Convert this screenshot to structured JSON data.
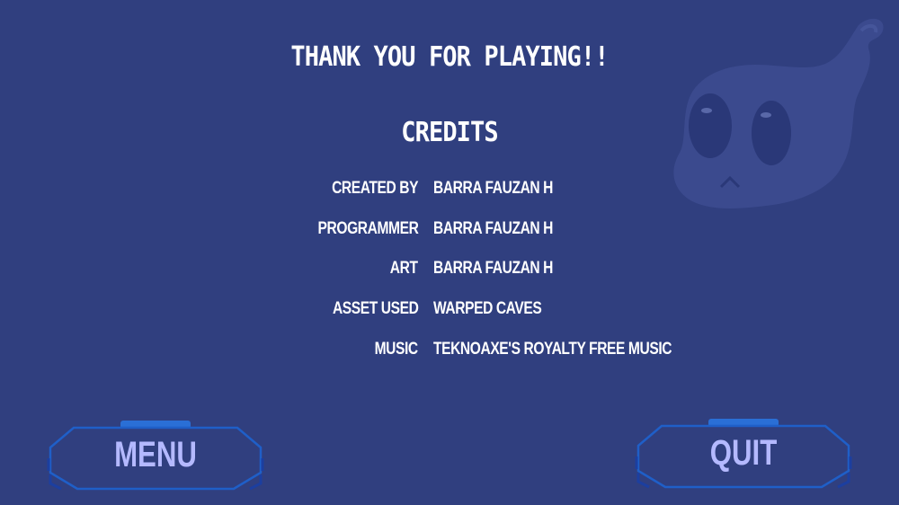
{
  "screen": {
    "title": "THANK YOU FOR PLAYING!!",
    "credits_heading": "CREDITS"
  },
  "credits": [
    {
      "label": "CREATED BY",
      "value": "BARRA FAUZAN H"
    },
    {
      "label": "PROGRAMMER",
      "value": "BARRA FAUZAN H"
    },
    {
      "label": "ART",
      "value": "BARRA FAUZAN H"
    },
    {
      "label": "ASSET USED",
      "value": "WARPED CAVES"
    },
    {
      "label": "MUSIC",
      "value": "TEKNOAXE'S ROYALTY FREE MUSIC"
    }
  ],
  "buttons": {
    "menu_label": "MENU",
    "quit_label": "QUIT"
  },
  "colors": {
    "background": "#303f7f",
    "button_outline": "#1f5fc8",
    "button_tab": "#2a6fd6",
    "button_text": "#b4b9ff",
    "ghost": "#3c4b8f"
  }
}
